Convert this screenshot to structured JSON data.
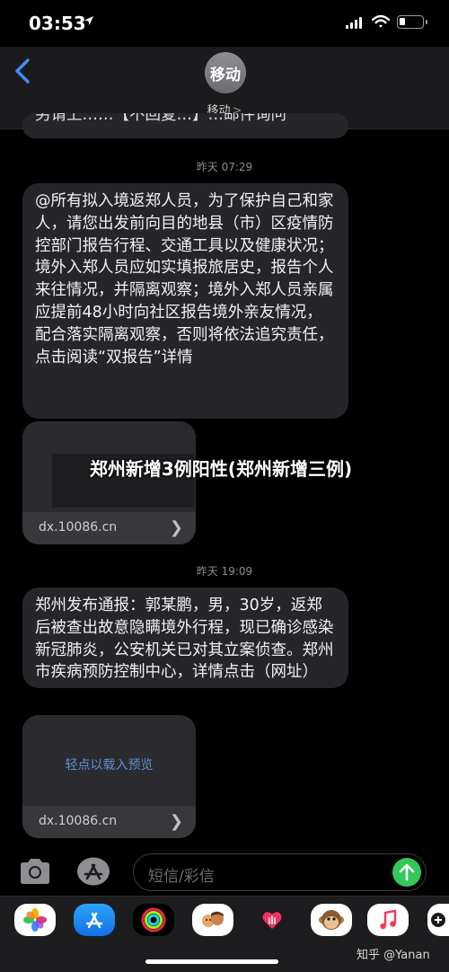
{
  "status_bar": {
    "time": "03:53"
  },
  "header": {
    "avatar_text": "移动",
    "contact_name": "移动",
    "contact_chevron": ">"
  },
  "messages": {
    "partial_text": "另请上……【不回复…】…邮件询问",
    "timestamp_1": "昨天 07:29",
    "bubble_1": "@所有拟入境返郑人员，为了保护自己和家人，请您出发前向目的地县（市）区疫情防控部门报告行程、交通工具以及健康状况；境外入郑人员应如实填报旅居史，报告个人来往情况，并隔离观察；境外入郑人员亲属应提前48小时向社区报告境外亲友情况，配合落实隔离观察，否则将依法追究责任，点击阅读“双报告”详情",
    "link_1_url": "dx.10086.cn",
    "timestamp_2": "昨天 19:09",
    "bubble_2": "郑州发布通报：郭某鹏，男，30岁，返郑后被查出故意隐瞒境外行程，现已确诊感染新冠肺炎，公安机关已对其立案侦查。郑州市疾病预防控制中心，详情点击（网址）",
    "link_2_preview": "轻点以载入预览",
    "link_2_url": "dx.10086.cn"
  },
  "overlay": {
    "title": "郑州新增3例阳性(郑州新增三例)"
  },
  "input_bar": {
    "placeholder": "短信/彩信"
  },
  "app_drawer": {
    "apps": [
      {
        "name": "photos-app-icon"
      },
      {
        "name": "app-store-icon"
      },
      {
        "name": "activity-icon"
      },
      {
        "name": "memoji-icon"
      },
      {
        "name": "digital-touch-icon"
      },
      {
        "name": "animoji-icon"
      },
      {
        "name": "music-icon"
      },
      {
        "name": "more-icon"
      }
    ],
    "watermark": "知乎 @Yanan"
  },
  "colors": {
    "bubble": "#26252a",
    "accent_blue": "#3e8ef7",
    "send_green": "#34c759",
    "link_preview_text": "#5f8fd0"
  }
}
